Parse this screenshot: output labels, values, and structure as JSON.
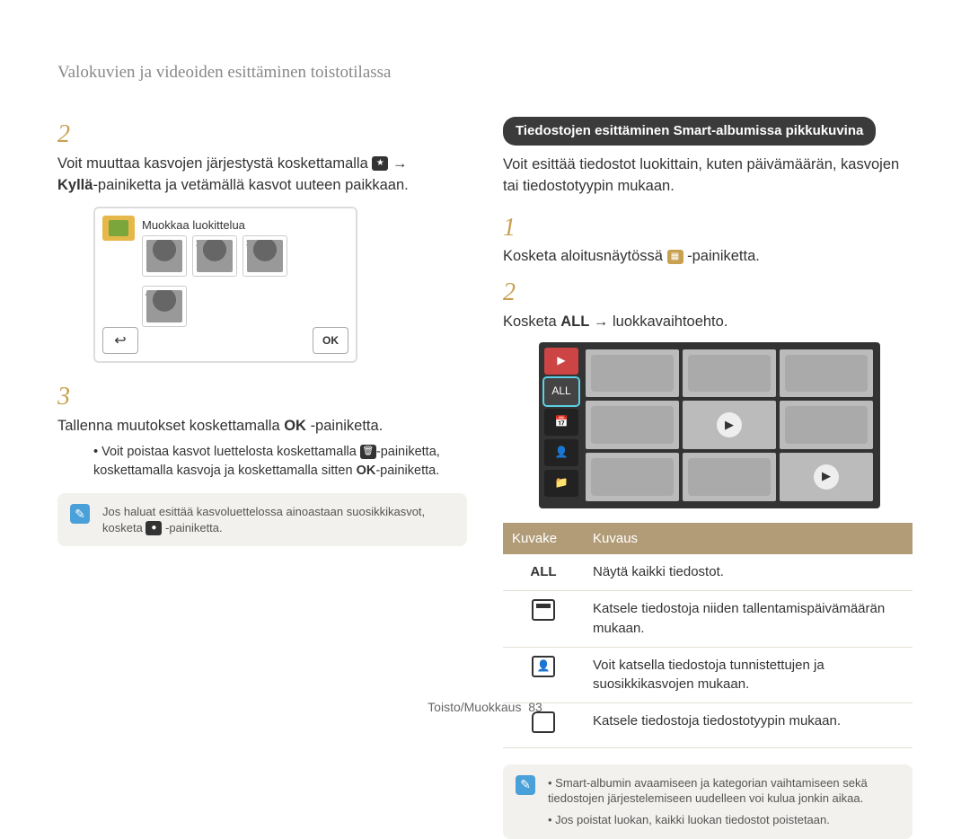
{
  "header": "Valokuvien ja videoiden esittäminen toistotilassa",
  "left": {
    "step2_pref": "Voit muuttaa kasvojen järjestystä koskettamalla ",
    "step2_arrow": " → ",
    "step2_kylla": "Kyllä",
    "step2_suf": "-painiketta ja vetämällä kasvot uuteen paikkaan.",
    "screenshot_label": "Muokkaa luokittelua",
    "thumb_nums": {
      "n1": "1",
      "n2": "2",
      "n3": "3",
      "n4": "4"
    },
    "ok": "OK",
    "step3_pref": "Tallenna muutokset koskettamalla ",
    "step3_suf": "-painiketta.",
    "bullet_pref": "Voit poistaa kasvot luettelosta koskettamalla ",
    "bullet_mid": "-painiketta, koskettamalla kasvoja ja koskettamalla sitten ",
    "bullet_suf": "-painiketta.",
    "note_pref": "Jos haluat esittää kasvoluettelossa ainoastaan suosikkikasvot, kosketa ",
    "note_suf": "-painiketta."
  },
  "right": {
    "heading": "Tiedostojen esittäminen Smart-albumissa pikkukuvina",
    "intro": "Voit esittää tiedostot luokittain, kuten päivämäärän, kasvojen tai tiedostotyypin mukaan.",
    "step1_pref": "Kosketa aloitusnäytössä ",
    "step1_suf": "-painiketta.",
    "step2_pref": "Kosketa ",
    "step2_all": "ALL",
    "step2_suf": " → luokkavaihtoehto.",
    "tab_all": "ALL",
    "table": {
      "h1": "Kuvake",
      "h2": "Kuvaus",
      "r1_icon": "ALL",
      "r1": "Näytä kaikki tiedostot.",
      "r2": "Katsele tiedostoja niiden tallentamispäivämäärän mukaan.",
      "r3": "Voit katsella tiedostoja tunnistettujen ja suosikkikasvojen mukaan.",
      "r4": "Katsele tiedostoja tiedostotyypin mukaan."
    },
    "note1": "Smart-albumin avaamiseen ja kategorian vaihtamiseen sekä tiedostojen järjestelemiseen uudelleen voi kulua jonkin aikaa.",
    "note2": "Jos poistat luokan, kaikki luokan tiedostot poistetaan."
  },
  "footer": {
    "section": "Toisto/Muokkaus",
    "page": "83"
  }
}
